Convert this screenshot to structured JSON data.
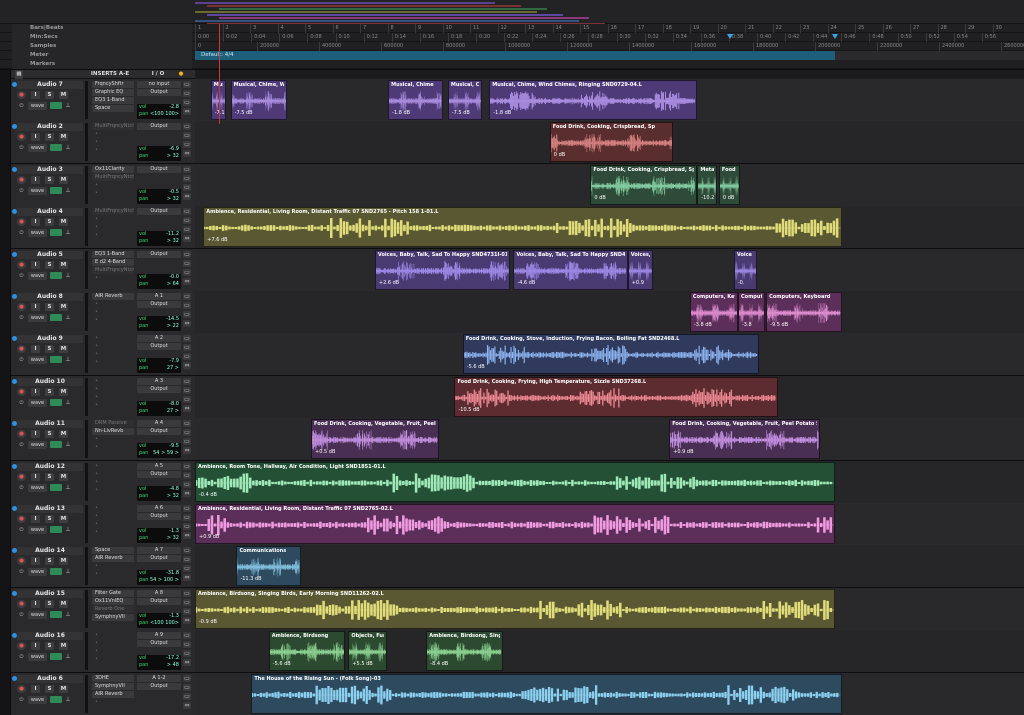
{
  "rulers": [
    {
      "name": "Bars|Beats",
      "ticks": [
        "1",
        "2",
        "3",
        "4",
        "5",
        "6",
        "7",
        "8",
        "9",
        "10",
        "11",
        "12",
        "13",
        "14",
        "15",
        "16",
        "17",
        "18",
        "19",
        "20",
        "21",
        "22",
        "23",
        "24",
        "25",
        "26",
        "27",
        "28",
        "29",
        "30"
      ]
    },
    {
      "name": "Min:Secs",
      "ticks": [
        "0:00",
        "0:02",
        "0:04",
        "0:06",
        "0:08",
        "0:10",
        "0:12",
        "0:14",
        "0:16",
        "0:18",
        "0:20",
        "0:22",
        "0:24",
        "0:26",
        "0:28",
        "0:30",
        "0:32",
        "0:34",
        "0:36",
        "0:38",
        "0:40",
        "0:42",
        "0:44",
        "0:46",
        "0:48",
        "0:50",
        "0:52",
        "0:54",
        "0:56"
      ]
    },
    {
      "name": "Samples",
      "ticks": [
        "0",
        "200000",
        "400000",
        "600000",
        "800000",
        "1000000",
        "1200000",
        "1400000",
        "1600000",
        "1800000",
        "2000000",
        "2200000",
        "2400000",
        "2600000"
      ]
    },
    {
      "name": "Meter",
      "value": "Default: 4/4"
    },
    {
      "name": "Markers"
    }
  ],
  "mix_header": {
    "inserts": "INSERTS A-E",
    "io": "I / O"
  },
  "colors": {
    "purple": "#4f3a78",
    "maroon": "#5a2e2e",
    "green": "#2e4a38",
    "olive": "#5a5832",
    "violet": "#4a3a72",
    "magenta": "#5c2f5a",
    "navy": "#2f3a5c",
    "red": "#5c2c30",
    "darkgreen": "#245036",
    "plum": "#4a2f55",
    "steel": "#2e4a5e",
    "forest": "#2c4a30"
  },
  "tracks": [
    {
      "name": "Audio 7",
      "inserts": [
        "FrqncyShftr",
        "Graphic EQ",
        "EQ3 1-Band",
        "Space"
      ],
      "io": [
        "no input",
        "Output"
      ],
      "vol": "-2.8",
      "pan": "<100  100>",
      "clips": [
        {
          "label": "Musical, Chime, Wir",
          "gain": "-7.1",
          "x": 0.019,
          "w": 0.018,
          "color": "purple"
        },
        {
          "label": "Musical, Chime, Wir",
          "gain": "-7.5 dB",
          "x": 0.043,
          "w": 0.068,
          "color": "purple"
        },
        {
          "label": "Musical, Chime",
          "gain": "-1.8 dB",
          "x": 0.233,
          "w": 0.066,
          "color": "purple"
        },
        {
          "label": "Musical, Chi",
          "gain": "-7.5 dB",
          "x": 0.305,
          "w": 0.041,
          "color": "purple"
        },
        {
          "label": "Musical, Chime, Wind Chimes, Ringing SND0729-04.L",
          "gain": "-1.8 dB",
          "x": 0.355,
          "w": 0.25,
          "color": "purple"
        }
      ]
    },
    {
      "name": "Audio 2",
      "inserts": [
        "MultiFrqncyNtch"
      ],
      "io": [
        "Output"
      ],
      "vol": "-6.9",
      "pan": "> 32",
      "clips": [
        {
          "label": "Food  Drink, Cooking, Crispbread, Sp",
          "gain": "0 dB",
          "x": 0.428,
          "w": 0.149,
          "color": "maroon"
        }
      ]
    },
    {
      "name": "Audio 3",
      "inserts": [
        "Ox11Clarity",
        "MultiFrqncyNtch"
      ],
      "io": [
        "Output"
      ],
      "vol": "-0.5",
      "pan": "> 32",
      "clips": [
        {
          "label": "Food  Drink, Cooking, Crispbread, Spr",
          "gain": "0 dB",
          "x": 0.477,
          "w": 0.128,
          "color": "green"
        },
        {
          "label": "Metal, I",
          "gain": "-10.2",
          "x": 0.606,
          "w": 0.024,
          "color": "green"
        },
        {
          "label": "Food",
          "gain": "0 dB",
          "x": 0.632,
          "w": 0.025,
          "color": "green"
        }
      ]
    },
    {
      "name": "Audio 4",
      "inserts": [
        "MultiFrqncyNtch"
      ],
      "io": [
        "Output"
      ],
      "vol": "-11.2",
      "pan": "> 32",
      "clips": [
        {
          "label": "Ambience, Residential, Living Room, Distant Traffic 07 SND2765 - Pitch 158 1-01.L",
          "gain": "+7.6 dB",
          "x": 0.01,
          "w": 0.77,
          "color": "olive"
        }
      ]
    },
    {
      "name": "Audio 5",
      "inserts": [
        "EQ3 1-Band",
        "E d2 4-Band",
        "MultiFrqncyNtch"
      ],
      "io": [
        "Output"
      ],
      "vol": "-0.0",
      "pan": "> 64",
      "clips": [
        {
          "label": "Voices, Baby, Talk, Sad To Happy SND4731I-01.L",
          "gain": "+2.6 dB",
          "x": 0.217,
          "w": 0.163,
          "color": "violet"
        },
        {
          "label": "Voices, Baby, Talk, Sad To Happy SND4731",
          "gain": "-4.6 dB",
          "x": 0.384,
          "w": 0.138,
          "color": "violet"
        },
        {
          "label": "Voices,",
          "gain": "+0.9",
          "x": 0.522,
          "w": 0.03,
          "color": "violet"
        },
        {
          "label": "Voice",
          "gain": "-0.",
          "x": 0.65,
          "w": 0.028,
          "color": "violet"
        }
      ]
    },
    {
      "name": "Audio 8",
      "inserts": [
        "AIR Reverb"
      ],
      "io": [
        "A 1",
        "Output"
      ],
      "vol": "-14.5",
      "pan": "> 22",
      "clips": [
        {
          "label": "Computers, Key",
          "gain": "-3.8 dB",
          "x": 0.597,
          "w": 0.058,
          "color": "magenta"
        },
        {
          "label": "Compute",
          "gain": "-3.8",
          "x": 0.655,
          "w": 0.033,
          "color": "magenta"
        },
        {
          "label": "Computers, Keyboard",
          "gain": "-9.5 dB",
          "x": 0.689,
          "w": 0.091,
          "color": "magenta"
        }
      ]
    },
    {
      "name": "Audio 9",
      "inserts": [],
      "io": [
        "A 2",
        "Output"
      ],
      "vol": "-7.9",
      "pan": "27 >",
      "clips": [
        {
          "label": "Food  Drink, Cooking, Stove, Induction, Frying Bacon, Boiling Fat SND2468.L",
          "gain": "-5.6 dB",
          "x": 0.323,
          "w": 0.357,
          "color": "navy"
        }
      ]
    },
    {
      "name": "Audio 10",
      "inserts": [],
      "io": [
        "A 3",
        "Output"
      ],
      "vol": "-8.0",
      "pan": "27 >",
      "clips": [
        {
          "label": "Food  Drink, Cooking, Frying, High Temperature, Sizzle SND37268.L",
          "gain": "-10.5 dB",
          "x": 0.313,
          "w": 0.39,
          "color": "red"
        }
      ]
    },
    {
      "name": "Audio 11",
      "inserts": [
        "DRM Passive",
        "Nn-LivRevb"
      ],
      "io": [
        "A 4",
        "Output"
      ],
      "vol": "-9.5",
      "pan": "54 >  59 >",
      "clips": [
        {
          "label": "Food  Drink, Cooking, Vegetable, Fruit, Peel",
          "gain": "+0.5 dB",
          "x": 0.14,
          "w": 0.154,
          "color": "plum"
        },
        {
          "label": "Food  Drink, Cooking, Vegetable, Fruit, Peel Potato S",
          "gain": "+0.9 dB",
          "x": 0.572,
          "w": 0.182,
          "color": "plum"
        }
      ]
    },
    {
      "name": "Audio 12",
      "inserts": [],
      "io": [
        "A 5",
        "Output"
      ],
      "vol": "-4.8",
      "pan": "> 32",
      "clips": [
        {
          "label": "Ambience, Room Tone, Hallway, Air Condition, Light  SND1851-01.L",
          "gain": "-0.4 dB",
          "x": 0.0,
          "w": 0.772,
          "color": "darkgreen"
        }
      ]
    },
    {
      "name": "Audio 13",
      "inserts": [],
      "io": [
        "A 6",
        "Output"
      ],
      "vol": "-1.3",
      "pan": "> 32",
      "clips": [
        {
          "label": "Ambience, Residential, Living Room, Distant Traffic 07 SND2765-02.L",
          "gain": "+0.9 dB",
          "x": 0.0,
          "w": 0.772,
          "color": "magenta"
        }
      ]
    },
    {
      "name": "Audio 14",
      "inserts": [
        "Space",
        "AIR Reverb"
      ],
      "io": [
        "A 7",
        "Output"
      ],
      "vol": "-31.8",
      "pan": "54 >  100 >",
      "clips": [
        {
          "label": "Communications",
          "gain": "-11.3 dB",
          "x": 0.05,
          "w": 0.078,
          "color": "steel"
        }
      ]
    },
    {
      "name": "Audio 15",
      "inserts": [
        "Filter Gate",
        "Ox11VnlEQ",
        "Reverb One",
        "SymphnyVII"
      ],
      "io": [
        "A 8",
        "Output"
      ],
      "vol": "-1.3",
      "pan": "<100  100>",
      "clips": [
        {
          "label": "Ambience, Birdsong, Singing Birds, Early Morning SND11262-02.L",
          "gain": "-0.9 dB",
          "x": 0.0,
          "w": 0.772,
          "color": "olive"
        }
      ]
    },
    {
      "name": "Audio 16",
      "inserts": [],
      "io": [
        "A 9",
        "Output"
      ],
      "vol": "-17.2",
      "pan": "> 48",
      "clips": [
        {
          "label": "Ambience, Birdsong",
          "gain": "-5.6 dB",
          "x": 0.089,
          "w": 0.092,
          "color": "forest"
        },
        {
          "label": "Objects, Furn",
          "gain": "+5.5 dB",
          "x": 0.185,
          "w": 0.047,
          "color": "forest"
        },
        {
          "label": "Ambience, Birdsong, Singing",
          "gain": "-8.4 dB",
          "x": 0.279,
          "w": 0.092,
          "color": "forest"
        }
      ]
    },
    {
      "name": "Audio 6",
      "inserts": [
        "3DHE",
        "SymphnyVII",
        "AIR Reverb"
      ],
      "io": [
        "A 1-2",
        "Output"
      ],
      "vol": "",
      "pan": "",
      "clips": [
        {
          "label": "The House of the Rising Sun - (Folk Song)-03",
          "gain": "",
          "x": 0.068,
          "w": 0.712,
          "color": "steel"
        }
      ]
    }
  ]
}
